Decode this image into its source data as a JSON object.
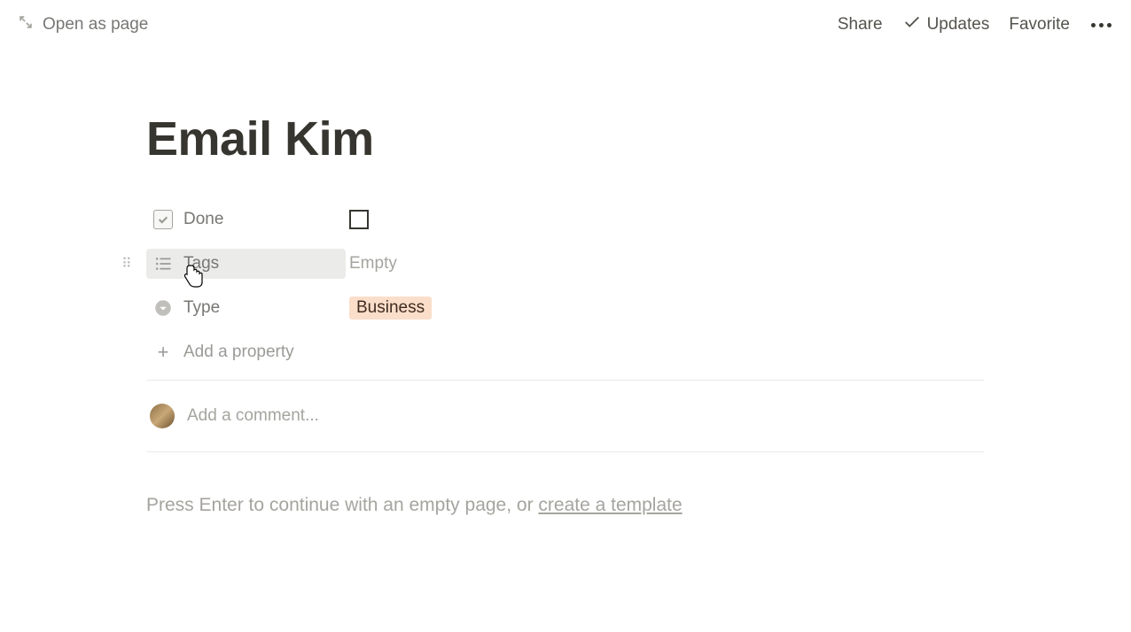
{
  "topbar": {
    "open_as_page": "Open as page",
    "share": "Share",
    "updates": "Updates",
    "favorite": "Favorite"
  },
  "page": {
    "title": "Email Kim"
  },
  "properties": {
    "done": {
      "label": "Done",
      "checked": false
    },
    "tags": {
      "label": "Tags",
      "value": "Empty"
    },
    "type": {
      "label": "Type",
      "value": "Business"
    },
    "add_property": "Add a property"
  },
  "comment": {
    "placeholder": "Add a comment..."
  },
  "empty_prompt": {
    "prefix": "Press Enter to continue with an empty page, or ",
    "link": "create a template"
  }
}
